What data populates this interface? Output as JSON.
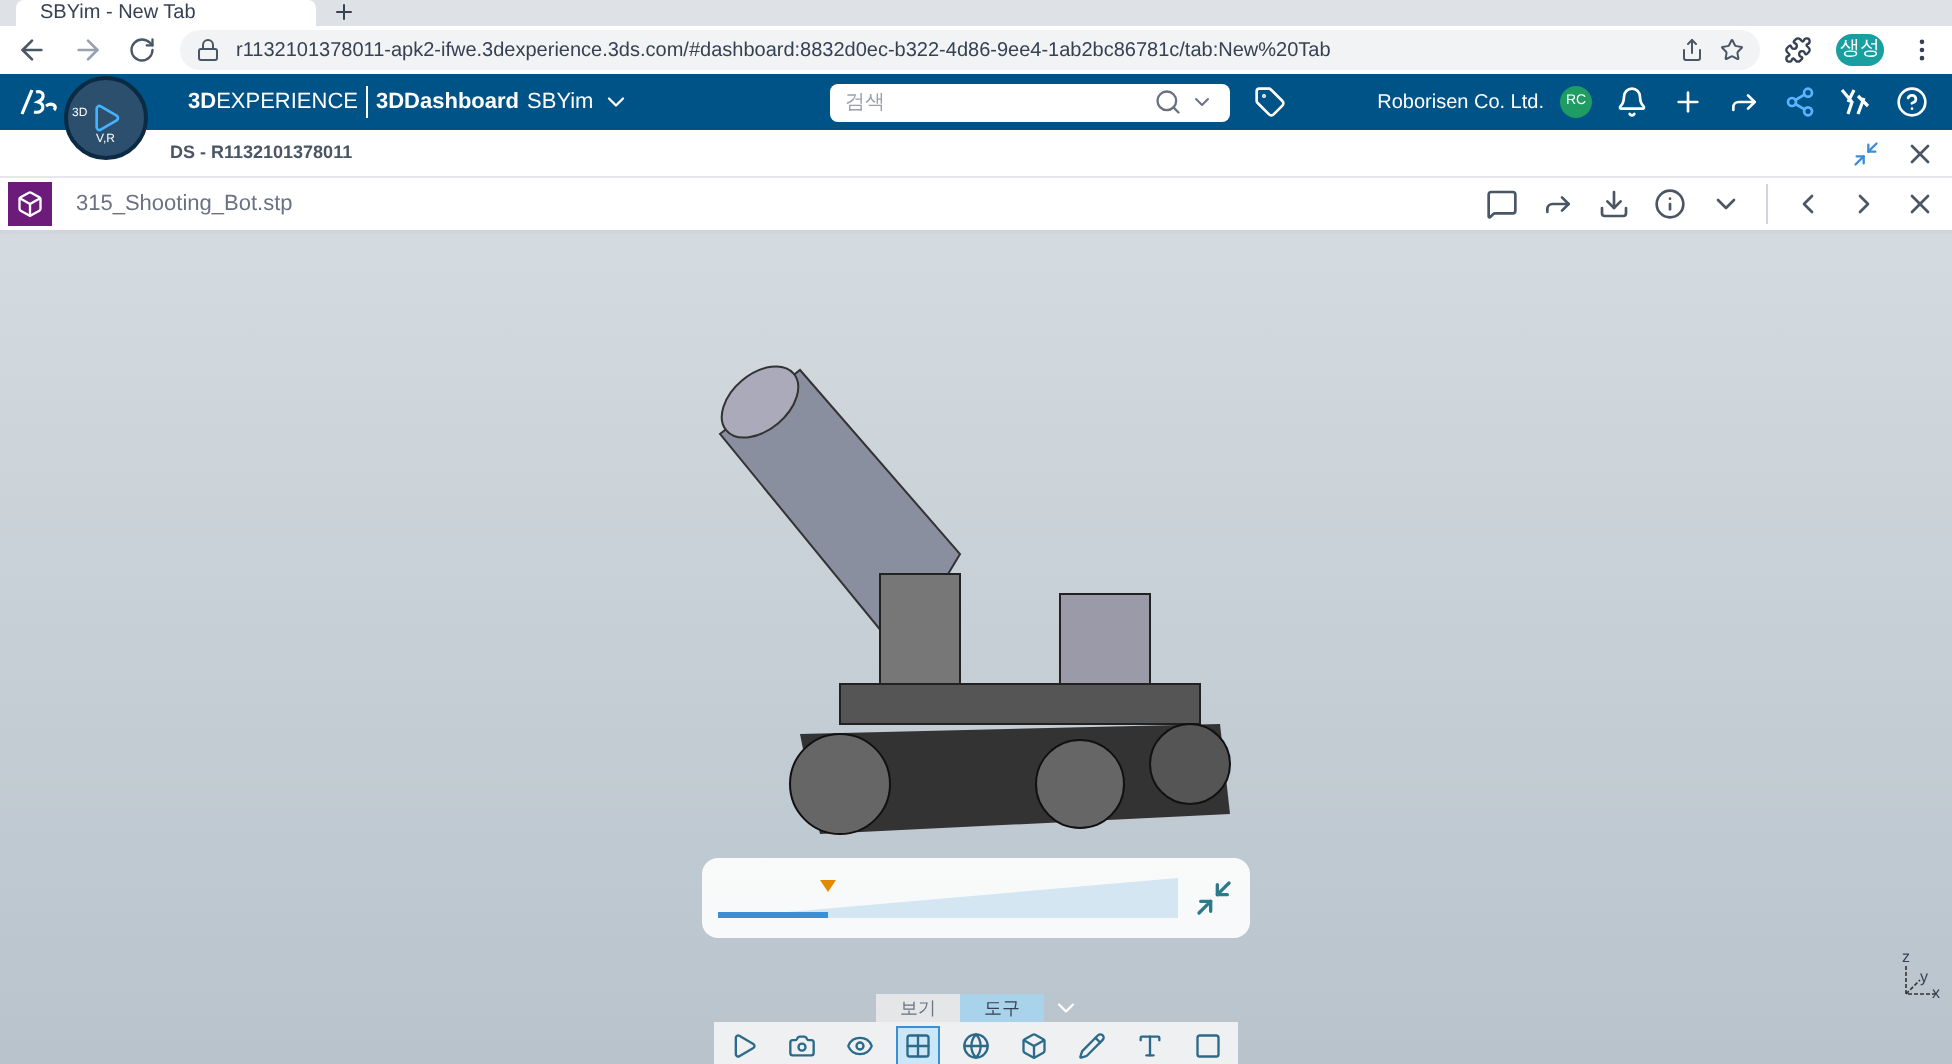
{
  "browser": {
    "tab_title": "SBYim - New Tab",
    "url": "r1132101378011-apk2-ifwe.3dexperience.3ds.com/#dashboard:8832d0ec-b322-4d86-9ee4-1ab2bc86781c/tab:New%20Tab",
    "profile": "생성"
  },
  "header": {
    "brand_bold": "3D",
    "brand_rest": "EXPERIENCE",
    "app": "3DDashboard",
    "user": "SBYim",
    "compass_labels": [
      "3D",
      "V,R"
    ],
    "search": {
      "placeholder": "검색"
    },
    "company": "Roborisen Co. Ltd.",
    "avatar": "RC"
  },
  "dashboard_title": "DS - R1132101378011",
  "file": {
    "name": "315_Shooting_Bot.stp"
  },
  "viewer": {
    "slider": {
      "level": 0.24
    },
    "toolbar_tabs": [
      {
        "label": "보기",
        "selected": false
      },
      {
        "label": "도구",
        "selected": true
      }
    ],
    "tools": [
      {
        "kind": "play",
        "active": false
      },
      {
        "kind": "camera",
        "active": false
      },
      {
        "kind": "eye",
        "active": false
      },
      {
        "kind": "grid",
        "active": true
      },
      {
        "kind": "globe",
        "active": false
      },
      {
        "kind": "cube",
        "active": false
      },
      {
        "kind": "pencil",
        "active": false
      },
      {
        "kind": "text",
        "active": false
      },
      {
        "kind": "frame",
        "active": false
      }
    ],
    "axes": [
      "z",
      "y",
      "x"
    ]
  }
}
